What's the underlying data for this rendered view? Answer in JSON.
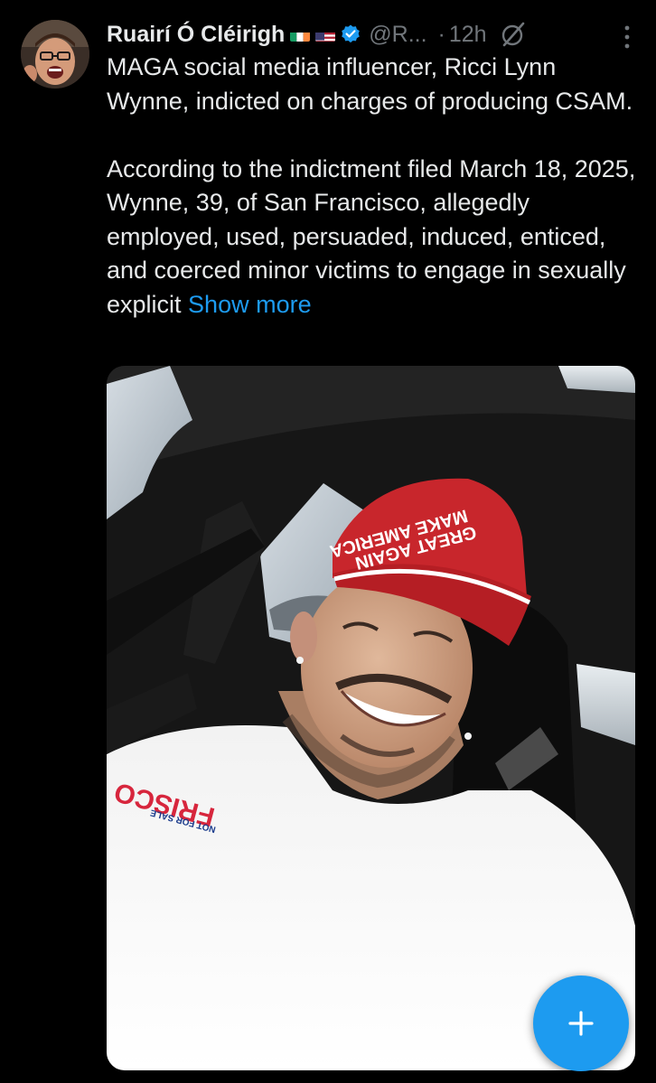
{
  "author": {
    "display_name": "Ruairí Ó Cléirigh",
    "handle": "@R...",
    "separator": "·",
    "time": "12h",
    "flags": [
      "ireland-flag",
      "us-flag"
    ],
    "verified_icon": "verified-badge-icon",
    "avatar_icon": "avatar"
  },
  "tweet": {
    "paragraph1": "MAGA social media influencer, Ricci Lynn Wynne, indicted on charges of producing CSAM.",
    "paragraph2": "According to the indictment filed March 18, 2025, Wynne, 39, of San Francisco, allegedly employed, used, persuaded, induced, enticed, and coerced minor victims to engage in sexually explicit",
    "show_more": "Show more"
  },
  "media": {
    "hat_text_line1": "MAKE AMERICA",
    "hat_text_line2": "GREAT AGAIN",
    "shirt_text": "FRISCO",
    "shirt_subtext": "NOT FOR SALE"
  },
  "icons": {
    "grok": "grok-icon",
    "more": "more-options-icon",
    "compose": "plus-icon"
  },
  "colors": {
    "background": "#000000",
    "text": "#e7e9ea",
    "muted": "#71767b",
    "accent": "#1d9bf0",
    "hat_red": "#c8262c"
  }
}
